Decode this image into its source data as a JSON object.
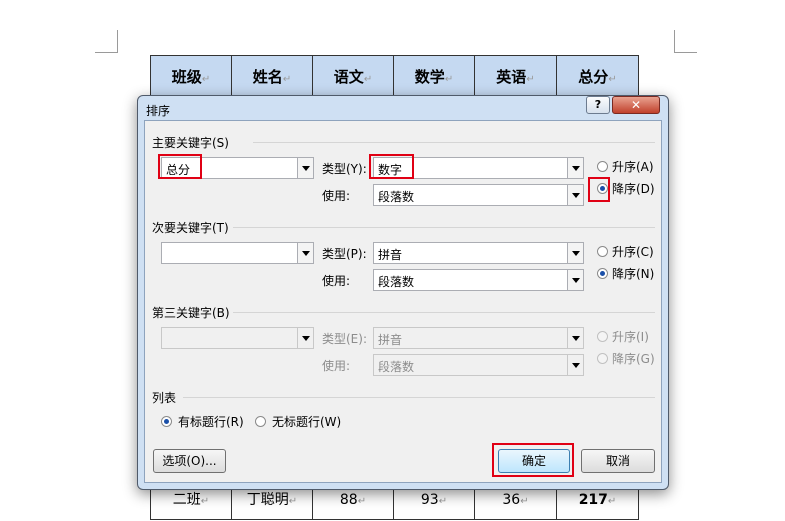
{
  "doc": {
    "headers": [
      "班级",
      "姓名",
      "语文",
      "数学",
      "英语",
      "总分"
    ],
    "visible_row": [
      "二班",
      "丁聪明",
      "88",
      "93",
      "36",
      "217"
    ],
    "para_mark": "↵"
  },
  "dialog": {
    "title": "排序",
    "help_symbol": "?",
    "close_symbol": "✕",
    "primary": {
      "label": "主要关键字(S)",
      "key": "总分",
      "type_label": "类型(Y):",
      "type_value": "数字",
      "use_label": "使用:",
      "use_value": "段落数",
      "asc_label": "升序(A)",
      "desc_label": "降序(D)",
      "selected": "desc"
    },
    "secondary": {
      "label": "次要关键字(T)",
      "key": "",
      "type_label": "类型(P):",
      "type_value": "拼音",
      "use_label": "使用:",
      "use_value": "段落数",
      "asc_label": "升序(C)",
      "desc_label": "降序(N)",
      "selected": "desc"
    },
    "tertiary": {
      "label": "第三关键字(B)",
      "key": "",
      "type_label": "类型(E):",
      "type_value": "拼音",
      "use_label": "使用:",
      "use_value": "段落数",
      "asc_label": "升序(I)",
      "desc_label": "降序(G)",
      "selected": "asc"
    },
    "list": {
      "label": "列表",
      "has_header_label": "有标题行(R)",
      "no_header_label": "无标题行(W)",
      "selected": "has_header"
    },
    "buttons": {
      "options": "选项(O)...",
      "ok": "确定",
      "cancel": "取消"
    }
  },
  "colors": {
    "header_fill": "#c5d9f1",
    "highlight": "#e00014",
    "dialog_frame": "#cfe0f3"
  }
}
